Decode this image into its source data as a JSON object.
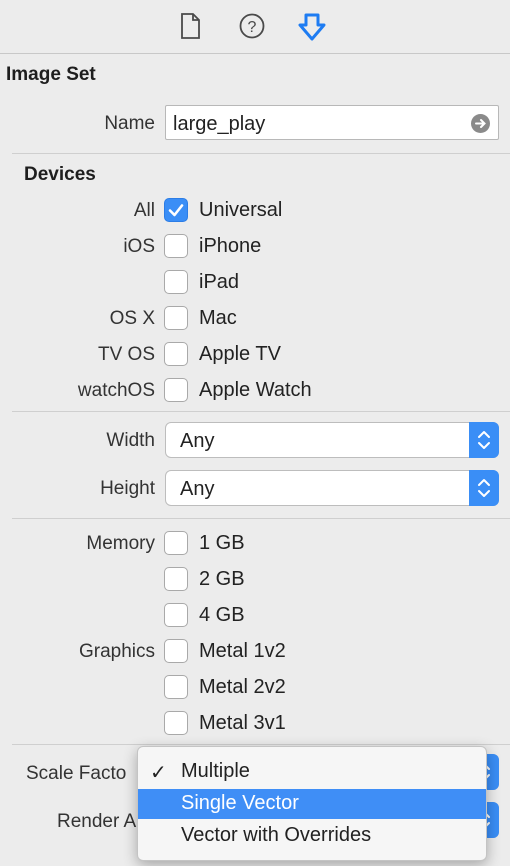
{
  "toolbar": {
    "icons": [
      "file-inspector-icon",
      "quick-help-icon",
      "attributes-inspector-icon"
    ]
  },
  "image_set": {
    "title": "Image Set",
    "name_label": "Name",
    "name_value": "large_play"
  },
  "devices": {
    "title": "Devices",
    "rows": [
      {
        "group": "All",
        "label": "Universal",
        "checked": true
      },
      {
        "group": "iOS",
        "label": "iPhone",
        "checked": false
      },
      {
        "group": "",
        "label": "iPad",
        "checked": false
      },
      {
        "group": "OS X",
        "label": "Mac",
        "checked": false
      },
      {
        "group": "TV OS",
        "label": "Apple TV",
        "checked": false
      },
      {
        "group": "watchOS",
        "label": "Apple Watch",
        "checked": false
      }
    ]
  },
  "size": {
    "width_label": "Width",
    "width_value": "Any",
    "height_label": "Height",
    "height_value": "Any"
  },
  "memory": {
    "label": "Memory",
    "options": [
      {
        "label": "1 GB",
        "checked": false
      },
      {
        "label": "2 GB",
        "checked": false
      },
      {
        "label": "4 GB",
        "checked": false
      }
    ]
  },
  "graphics": {
    "label": "Graphics",
    "options": [
      {
        "label": "Metal 1v2",
        "checked": false
      },
      {
        "label": "Metal 2v2",
        "checked": false
      },
      {
        "label": "Metal 3v1",
        "checked": false
      }
    ]
  },
  "bottom": {
    "scale_label": "Scale Facto",
    "render_label": "Render A"
  },
  "scale_menu": {
    "items": [
      {
        "label": "Multiple",
        "checked": true,
        "highlighted": false
      },
      {
        "label": "Single Vector",
        "checked": false,
        "highlighted": true
      },
      {
        "label": "Vector with Overrides",
        "checked": false,
        "highlighted": false
      }
    ]
  },
  "colors": {
    "accent": "#3a8ef6",
    "background": "#ececec"
  }
}
